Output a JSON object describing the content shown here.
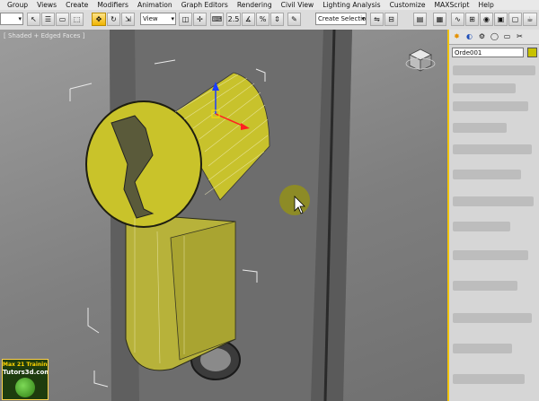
{
  "menu": [
    "Group",
    "Views",
    "Create",
    "Modifiers",
    "Animation",
    "Graph Editors",
    "Rendering",
    "Civil View",
    "Lighting Analysis",
    "Customize",
    "MAXScript",
    "Help"
  ],
  "toolbar": {
    "view_dropdown": "View",
    "selection_set_placeholder": "Create Selection Se",
    "snap_label": "2.5",
    "percent_label": "%"
  },
  "viewport": {
    "label": "[ Shaded + Edged Faces ]"
  },
  "command_panel": {
    "object_name": "Orde001",
    "object_color": "#c8c200"
  },
  "logo": {
    "line1": "Max 21 Training",
    "line2": "Tutors3d.com"
  }
}
